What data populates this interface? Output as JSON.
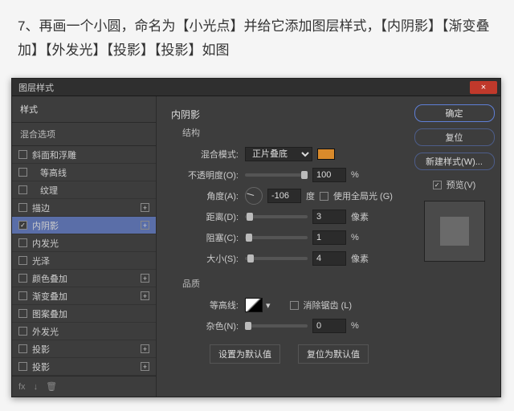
{
  "instruction": "7、再画一个小圆，命名为【小光点】并给它添加图层样式，【内阴影】【渐变叠加】【外发光】【投影】【投影】如图",
  "dialog": {
    "title": "图层样式",
    "close": "×"
  },
  "sidebar": {
    "header": "样式",
    "sub": "混合选项",
    "items": [
      {
        "label": "斜面和浮雕",
        "checked": false,
        "plus": false
      },
      {
        "label": "等高线",
        "checked": false,
        "plus": false,
        "indent": true
      },
      {
        "label": "纹理",
        "checked": false,
        "plus": false,
        "indent": true
      },
      {
        "label": "描边",
        "checked": false,
        "plus": true
      },
      {
        "label": "内阴影",
        "checked": true,
        "plus": true,
        "selected": true
      },
      {
        "label": "内发光",
        "checked": false,
        "plus": false
      },
      {
        "label": "光泽",
        "checked": false,
        "plus": false
      },
      {
        "label": "颜色叠加",
        "checked": false,
        "plus": true
      },
      {
        "label": "渐变叠加",
        "checked": false,
        "plus": true
      },
      {
        "label": "图案叠加",
        "checked": false,
        "plus": false
      },
      {
        "label": "外发光",
        "checked": false,
        "plus": false
      },
      {
        "label": "投影",
        "checked": false,
        "plus": true
      },
      {
        "label": "投影",
        "checked": false,
        "plus": true
      }
    ],
    "footer": {
      "fx": "fx",
      "down": "↓",
      "trash": "🗑"
    }
  },
  "panel": {
    "title": "内阴影",
    "structure": {
      "title": "结构",
      "blendmode_label": "混合模式:",
      "blendmode_value": "正片叠底",
      "opacity_label": "不透明度(O):",
      "opacity_value": "100",
      "opacity_unit": "%",
      "angle_label": "角度(A):",
      "angle_value": "-106",
      "angle_unit": "度",
      "global_label": "使用全局光 (G)",
      "distance_label": "距离(D):",
      "distance_value": "3",
      "distance_unit": "像素",
      "choke_label": "阻塞(C):",
      "choke_value": "1",
      "choke_unit": "%",
      "size_label": "大小(S):",
      "size_value": "4",
      "size_unit": "像素"
    },
    "quality": {
      "title": "品质",
      "contour_label": "等高线:",
      "antialias_label": "消除锯齿 (L)",
      "noise_label": "杂色(N):",
      "noise_value": "0",
      "noise_unit": "%"
    },
    "defaults": {
      "set": "设置为默认值",
      "reset": "复位为默认值"
    }
  },
  "right": {
    "ok": "确定",
    "cancel": "复位",
    "newstyle": "新建样式(W)...",
    "preview_label": "预览(V)"
  }
}
